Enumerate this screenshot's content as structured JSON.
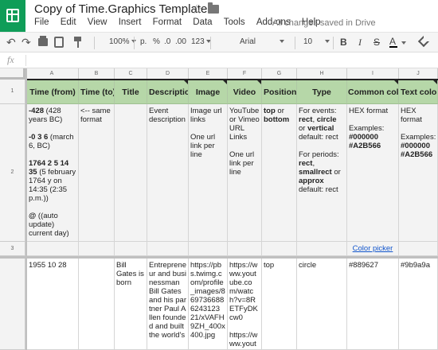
{
  "app": {
    "title": "Copy of Time.Graphics Template",
    "save_status": "All changes saved in Drive",
    "colors": {
      "brand": "#0f9d58",
      "header_fill": "#b6d7a8",
      "link": "#1155cc"
    },
    "icons": [
      "sheets-logo-icon",
      "star-icon",
      "folder-icon"
    ]
  },
  "menu": [
    "File",
    "Edit",
    "View",
    "Insert",
    "Format",
    "Data",
    "Tools",
    "Add-ons",
    "Help"
  ],
  "toolbar": {
    "zoom": "100%",
    "currency": "p.",
    "percent": "%",
    "decimal_less": ".0",
    "decimal_more": ".00",
    "more_formats": "123",
    "font": "Arial",
    "font_size": "10",
    "bold": "B",
    "italic": "I",
    "strike": "S",
    "text_color": "A"
  },
  "formula_bar": {
    "fx": "fx",
    "value": ""
  },
  "grid": {
    "columns": [
      "A",
      "B",
      "C",
      "D",
      "E",
      "F",
      "G",
      "H",
      "I",
      "J"
    ],
    "rows": [
      "1",
      "2",
      "3"
    ],
    "headers": [
      "Time (from)",
      "Time (to)",
      "Title",
      "Description",
      "Image",
      "Video",
      "Position",
      "Type",
      "Common color",
      "Text color"
    ],
    "row2": {
      "A": {
        "l1_bold": "-428",
        "l1_rest": " (428 years BC)",
        "l2_bold": "-0 3 6",
        "l2_rest": " (march 6, BC)",
        "l3_bold": "1764 2 5 14 35",
        "l3_rest": " (5 february 1764 y on 14:35 (2:35 p.m.))",
        "l4_bold": "@",
        "l4_rest": " ((auto update) current day)"
      },
      "B": "<-- same format",
      "D": "Event description",
      "E": {
        "l1": "Image url links",
        "l2": "One url link per line"
      },
      "F": {
        "l1": "YouTube or Vimeo URL Links",
        "l2": "One url link per line"
      },
      "G": {
        "b1": "top",
        "t1": " or ",
        "b2": "bottom"
      },
      "H": {
        "l1": "For events: ",
        "b1": "rect",
        "t1": ", ",
        "b2": "circle",
        "t2": " or ",
        "b3": "vertical",
        "d1": "default: rect",
        "l2": "For periods: ",
        "b4": "rect",
        "t3": ", ",
        "b5": "smallrect",
        "t4": " or ",
        "b6": "approx",
        "d2": "default: rect"
      },
      "I": {
        "l1": "HEX format",
        "l2": "Examples:",
        "b1": "#000000",
        "b2": "#A2B566"
      },
      "J": {
        "l1": "HEX format",
        "l2": "Examples:",
        "b1": "#000000",
        "b2": "#A2B566"
      }
    },
    "row3": {
      "I": "Color picker"
    },
    "row4": {
      "A": "1955 10 28",
      "C": "Bill Gates is born",
      "D": "Entrepreneur and businessman Bill Gates and his partner Paul Allen founded and built the world's",
      "E": "https://pbs.twimg.com/profile_images/8697366886243123 21/xVAFH9ZH_400x400.jpg",
      "F1": "https://www.youtube.com/watch?v=8RETFyDKcw0",
      "F2": "https://www.youtube.com",
      "G": "top",
      "H": "circle",
      "I": "#889627",
      "J": "#9b9a9a"
    }
  }
}
